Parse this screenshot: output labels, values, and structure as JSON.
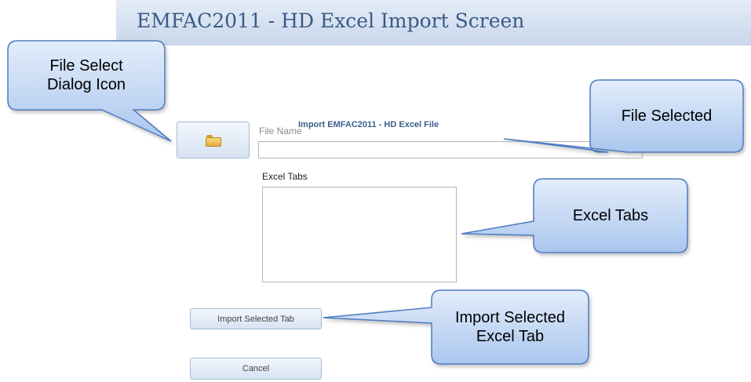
{
  "header": {
    "title": "EMFAC2011 - HD Excel Import Screen"
  },
  "form": {
    "heading": "Import EMFAC2011 - HD Excel File",
    "file_name_label": "File Name",
    "file_name_value": "",
    "excel_tabs_label": "Excel Tabs",
    "excel_tabs_items": [],
    "file_select_icon": "folder-open-icon",
    "import_button_label": "Import Selected Tab",
    "cancel_button_label": "Cancel"
  },
  "callouts": {
    "file_select": "File Select\nDialog Icon",
    "file_selected": "File Selected",
    "excel_tabs": "Excel Tabs",
    "import_selected": "Import Selected\nExcel Tab"
  },
  "colors": {
    "header_background": "#c8d7eb",
    "header_title": "#3a5a86",
    "callout_fill": "#c5d8f3",
    "callout_border": "#4f7cc0",
    "button_fill": "#d6e3f2"
  }
}
